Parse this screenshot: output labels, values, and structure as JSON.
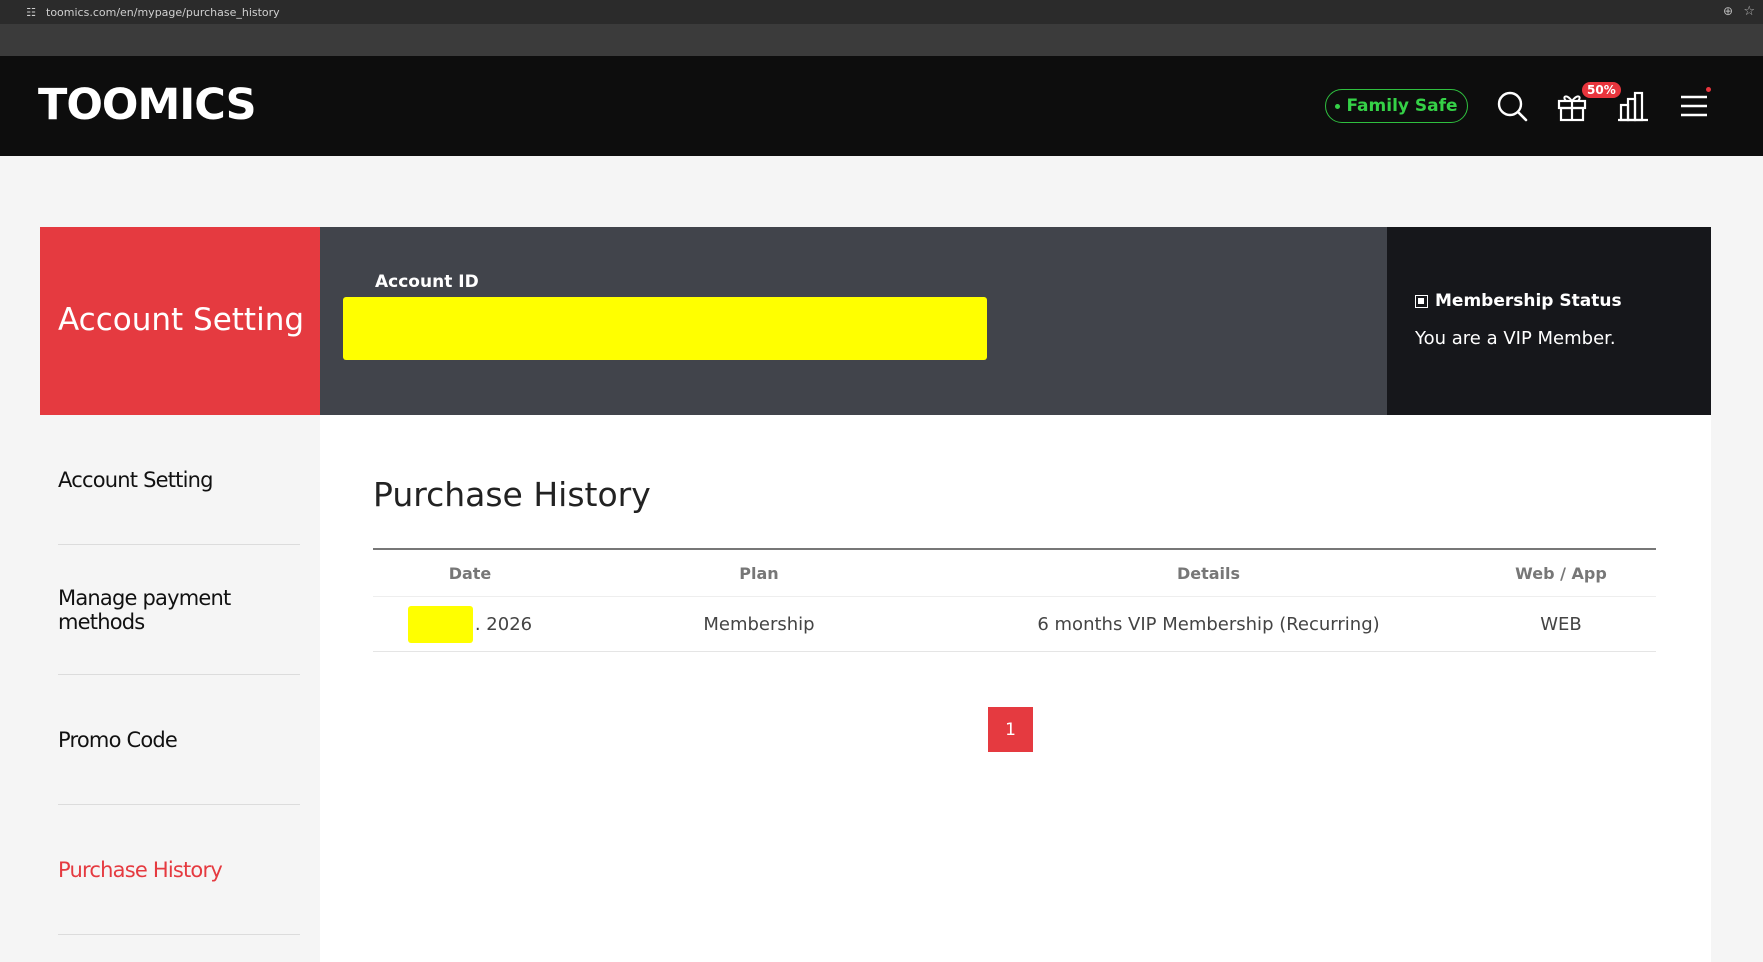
{
  "browser": {
    "url": "toomics.com/en/mypage/purchase_history"
  },
  "header": {
    "logo": "TOOMICS",
    "family_safe": "Family Safe",
    "promo_badge": "50%"
  },
  "banner": {
    "section_title": "Account Setting",
    "account_id_label": "Account ID",
    "membership_title": "Membership Status",
    "membership_text": "You are a VIP Member."
  },
  "sidebar": {
    "items": [
      {
        "label": "Account Setting"
      },
      {
        "label": "Manage payment methods"
      },
      {
        "label": "Promo Code"
      },
      {
        "label": "Purchase History"
      }
    ]
  },
  "main": {
    "title": "Purchase History",
    "columns": [
      "Date",
      "Plan",
      "Details",
      "Web / App"
    ],
    "rows": [
      {
        "date": ". 2026",
        "plan": "Membership",
        "details": "6 months VIP Membership (Recurring)",
        "platform": "WEB"
      }
    ],
    "pagination": {
      "current": "1"
    }
  },
  "colors": {
    "accent": "#e53a40",
    "header_bg": "#0d0d0d",
    "family_safe": "#35d147",
    "redaction": "#ffff00"
  }
}
